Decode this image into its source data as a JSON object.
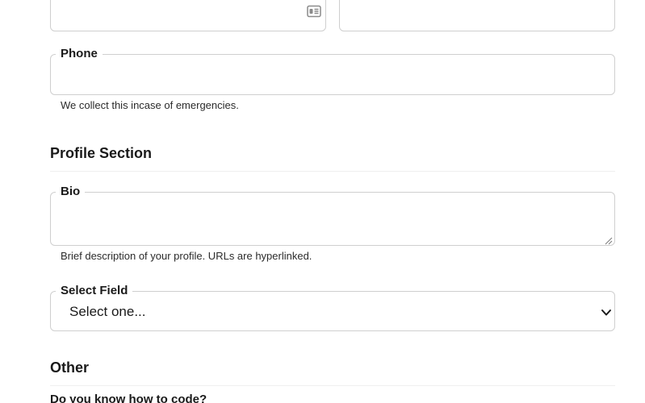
{
  "phone": {
    "label": "Phone",
    "help": "We collect this incase of emergencies."
  },
  "profile": {
    "heading": "Profile Section"
  },
  "bio": {
    "label": "Bio",
    "help": "Brief description of your profile. URLs are hyperlinked."
  },
  "select_field": {
    "label": "Select Field",
    "value": "Select one..."
  },
  "other": {
    "heading": "Other",
    "question": "Do you know how to code?"
  },
  "icons": {
    "contact_card": "contact-card-icon",
    "chevron": "chevron-down-icon",
    "resize": "resize-handle-icon"
  }
}
